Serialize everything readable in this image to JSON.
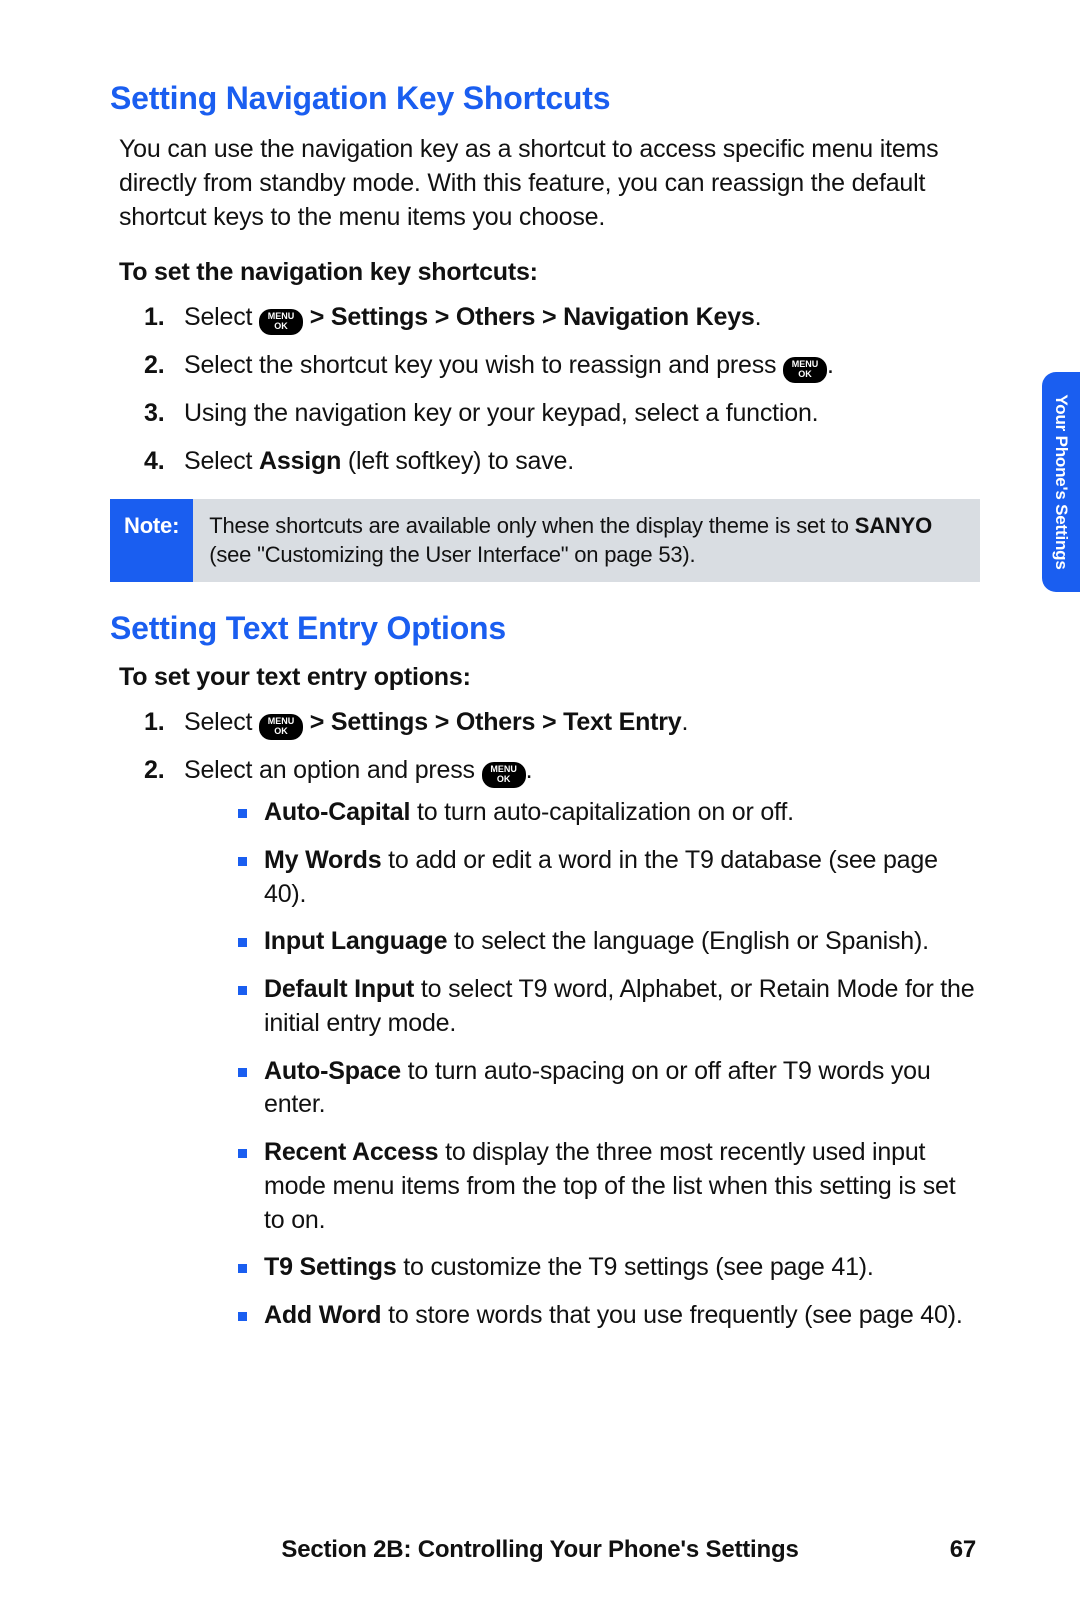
{
  "side_tab": "Your Phone's Settings",
  "icon": {
    "line1": "MENU",
    "line2": "OK"
  },
  "section1": {
    "heading": "Setting Navigation Key Shortcuts",
    "intro": "You can use the navigation key as a shortcut to access specific menu items directly from standby mode. With this feature, you can reassign the default shortcut keys to the menu items you choose.",
    "subhead": "To set the navigation key shortcuts:",
    "steps": {
      "s1_num": "1.",
      "s1_pre": "Select ",
      "s1_path": " > Settings > Others > Navigation Keys",
      "s1_end": ".",
      "s2_num": "2.",
      "s2_pre": "Select the shortcut key you wish to reassign and press ",
      "s2_end": ".",
      "s3_num": "3.",
      "s3": "Using the navigation key or your keypad, select a function.",
      "s4_num": "4.",
      "s4_pre": "Select ",
      "s4_b": "Assign",
      "s4_post": " (left softkey) to save."
    },
    "note_label": "Note:",
    "note_pre": "These shortcuts are available only when the display theme is set to ",
    "note_b": "SANYO",
    "note_post": " (see \"Customizing the User Interface\" on page 53)."
  },
  "section2": {
    "heading": "Setting Text Entry Options",
    "subhead": "To set your text entry options:",
    "steps": {
      "s1_num": "1.",
      "s1_pre": "Select ",
      "s1_path": " > Settings > Others > Text Entry",
      "s1_end": ".",
      "s2_num": "2.",
      "s2_pre": "Select an option and press ",
      "s2_end": "."
    },
    "bullets": {
      "b1_b": "Auto-Capital",
      "b1_t": " to turn auto-capitalization on or off.",
      "b2_b": "My Words",
      "b2_t": " to add or edit a word in the T9 database (see page 40).",
      "b3_b": "Input Language",
      "b3_t": " to select the language (English or Spanish).",
      "b4_b": "Default Input",
      "b4_t": " to select T9 word, Alphabet, or Retain Mode for the initial entry mode.",
      "b5_b": "Auto-Space",
      "b5_t": " to turn auto-spacing on or off after T9 words you enter.",
      "b6_b": "Recent Access",
      "b6_t": " to display the three most recently used input mode menu items from the top of the list when this setting is set to on.",
      "b7_b": "T9 Settings",
      "b7_t": " to customize the T9 settings (see page 41).",
      "b8_b": "Add Word",
      "b8_t": " to store words that you use frequently (see page 40)."
    }
  },
  "footer": {
    "text": "Section 2B: Controlling Your Phone's Settings",
    "page": "67"
  }
}
